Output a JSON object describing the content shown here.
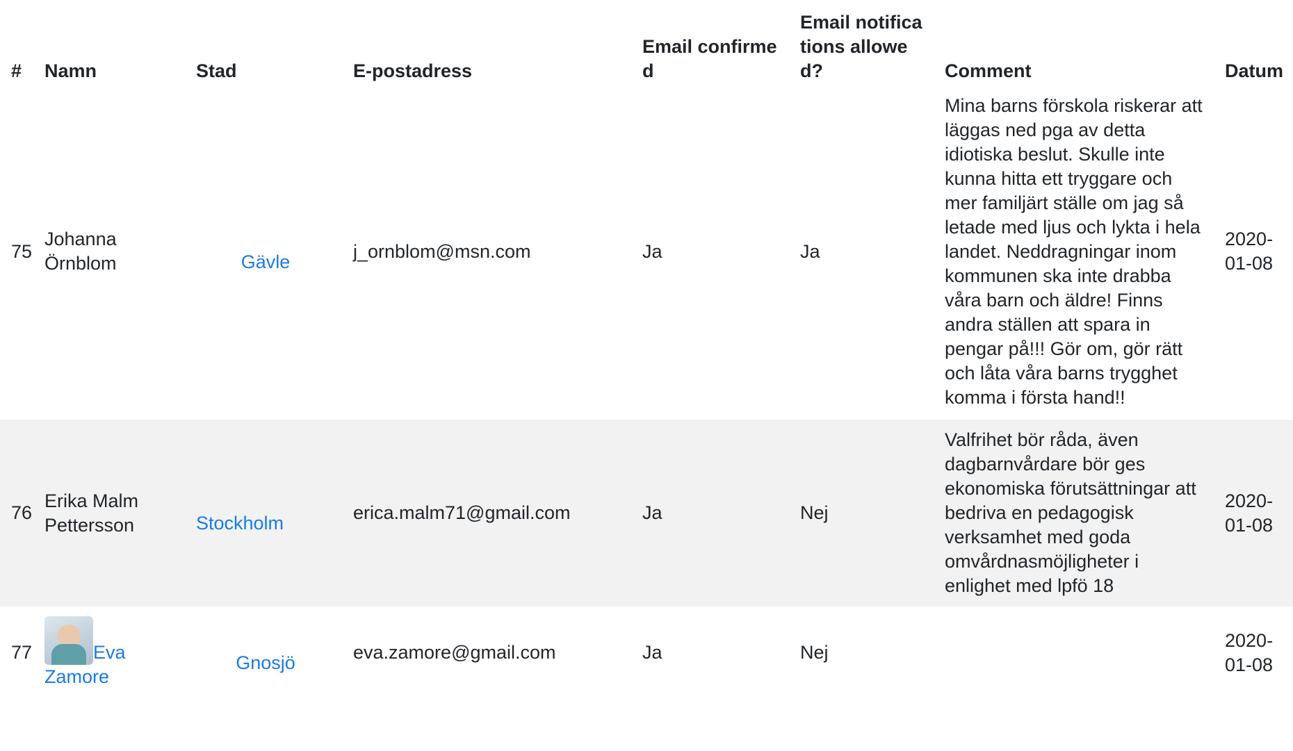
{
  "headers": {
    "num": "#",
    "name": "Namn",
    "city": "Stad",
    "email": "E-postadress",
    "confirmed": "Email confirmed",
    "notifications": "Email notifications allowed?",
    "comment": "Comment",
    "date": "Datum"
  },
  "rows": [
    {
      "num": "75",
      "name": "Johanna Örnblom",
      "city": "Gävle",
      "email": "j_ornblom@msn.com",
      "confirmed": "Ja",
      "notifications": "Ja",
      "comment": "Mina barns förskola riskerar att läggas ned pga av detta idiotiska beslut. Skulle inte kunna hitta ett tryggare och mer familjärt ställe om jag så letade med ljus och lykta i hela landet. Neddragningar inom kommunen ska inte drabba våra barn och äldre! Finns andra ställen att spara in pengar på!!! Gör om, gör rätt och låta våra barns trygghet komma i första hand!!",
      "date": "2020-01-08"
    },
    {
      "num": "76",
      "name": "Erika Malm Pettersson",
      "city": "Stockholm",
      "email": "erica.malm71@gmail.com",
      "confirmed": "Ja",
      "notifications": "Nej",
      "comment": "Valfrihet bör råda, även dagbarnvårdare bör ges ekonomiska förutsättningar att bedriva en pedagogisk verksamhet med goda omvårdnasmöjligheter i enlighet med lpfö 18",
      "date": "2020-01-08"
    },
    {
      "num": "77",
      "name": "Eva Zamore",
      "city": "Gnosjö",
      "email": "eva.zamore@gmail.com",
      "confirmed": "Ja",
      "notifications": "Nej",
      "comment": "",
      "date": "2020-01-08"
    }
  ]
}
